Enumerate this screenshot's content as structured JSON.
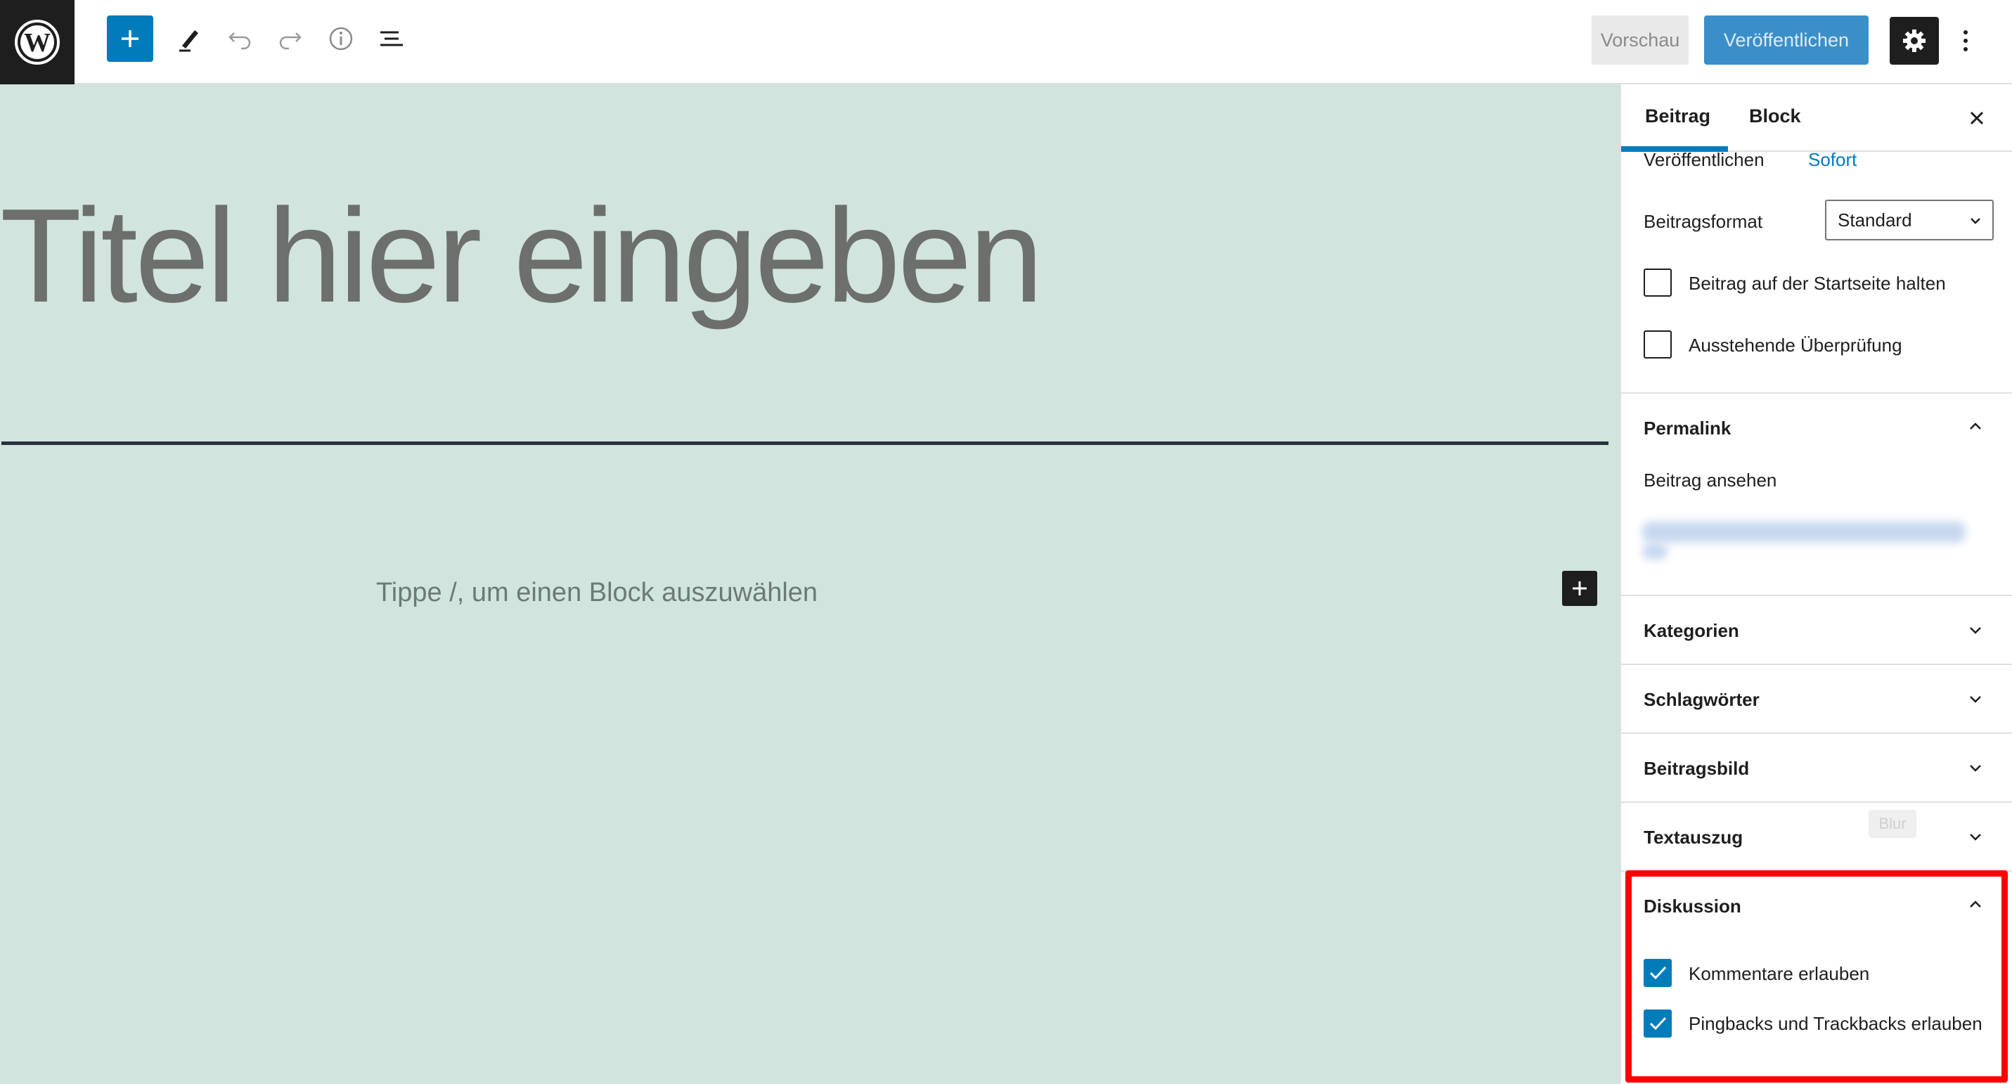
{
  "toolbar": {
    "logo_icon": "wordpress-logo-icon",
    "add_icon": "plus-icon",
    "edit_icon": "pencil-icon",
    "undo_icon": "undo-icon",
    "redo_icon": "redo-icon",
    "info_icon": "info-icon",
    "list_icon": "list-view-icon",
    "preview_label": "Vorschau",
    "publish_label": "Veröffentlichen",
    "settings_icon": "gear-icon",
    "more_icon": "vertical-ellipsis-icon",
    "accent_color": "#007cba"
  },
  "editor": {
    "title_placeholder": "Titel hier eingeben",
    "block_placeholder": "Tippe /, um einen Block auszuwählen",
    "background_color": "#d1e4dd"
  },
  "sidebar": {
    "tabs": [
      {
        "label": "Beitrag",
        "active": true
      },
      {
        "label": "Block",
        "active": false
      }
    ],
    "close_icon": "close-icon",
    "status": {
      "publish_label": "Veröffentlichen",
      "publish_value": "Sofort",
      "format_label": "Beitragsformat",
      "format_value": "Standard",
      "sticky_label": "Beitrag auf der Startseite halten",
      "sticky_checked": false,
      "pending_label": "Ausstehende Überprüfung",
      "pending_checked": false
    },
    "panels": {
      "permalink": {
        "title": "Permalink",
        "expanded": true,
        "view_label": "Beitrag ansehen"
      },
      "categories": {
        "title": "Kategorien",
        "expanded": false
      },
      "tags": {
        "title": "Schlagwörter",
        "expanded": false
      },
      "featured_image": {
        "title": "Beitragsbild",
        "expanded": false
      },
      "excerpt": {
        "title": "Textauszug",
        "expanded": false
      },
      "discussion": {
        "title": "Diskussion",
        "expanded": true,
        "allow_comments_label": "Kommentare erlauben",
        "allow_comments_checked": true,
        "allow_pingbacks_label": "Pingbacks und Trackbacks erlauben",
        "allow_pingbacks_checked": true
      }
    },
    "blur_tag": "Blur",
    "highlight_color": "#ff0000"
  }
}
